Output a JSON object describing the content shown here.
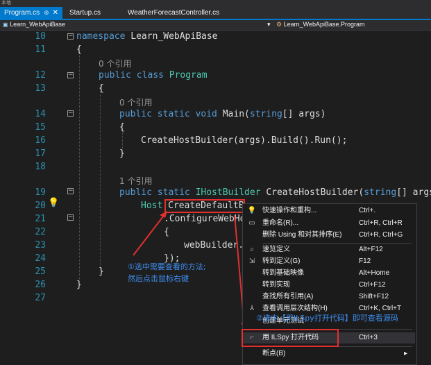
{
  "window": {
    "corner_label": "本地"
  },
  "tabs": [
    {
      "label": "Program.cs",
      "pin": "⊕",
      "close": "✕",
      "active": true
    },
    {
      "label": "Startup.cs",
      "active": false
    },
    {
      "label": "WeatherForecastController.cs",
      "active": false
    }
  ],
  "navbar": {
    "project": "Learn_WebApiBase",
    "dropdown_arrow": "▾",
    "member": "Learn_WebApiBase.Program"
  },
  "lines": [
    {
      "n": "10",
      "tokens": [
        {
          "t": "namespace ",
          "c": "kw"
        },
        {
          "t": "Learn_WebApiBase",
          "c": "fn"
        }
      ]
    },
    {
      "n": "11",
      "tokens": [
        {
          "t": "{",
          "c": "fn"
        }
      ]
    },
    {
      "n": "12",
      "ref": "0 个引用",
      "tokens": [
        {
          "t": "public class ",
          "c": "kw"
        },
        {
          "t": "Program",
          "c": "ty"
        }
      ]
    },
    {
      "n": "13",
      "tokens": [
        {
          "t": "{",
          "c": "fn"
        }
      ]
    },
    {
      "n": "14",
      "ref": "0 个引用",
      "tokens": [
        {
          "t": "public static void ",
          "c": "kw"
        },
        {
          "t": "Main(",
          "c": "fn"
        },
        {
          "t": "string",
          "c": "kw"
        },
        {
          "t": "[] args)",
          "c": "fn"
        }
      ]
    },
    {
      "n": "15",
      "tokens": [
        {
          "t": "{",
          "c": "fn"
        }
      ]
    },
    {
      "n": "16",
      "tokens": [
        {
          "t": "CreateHostBuilder(args).Build().Run();",
          "c": "fn"
        }
      ]
    },
    {
      "n": "17",
      "tokens": [
        {
          "t": "}",
          "c": "fn"
        }
      ]
    },
    {
      "n": "18",
      "tokens": []
    },
    {
      "n": "19",
      "ref": "1 个引用",
      "tokens": [
        {
          "t": "public static ",
          "c": "kw"
        },
        {
          "t": "IHostBuilder ",
          "c": "ty"
        },
        {
          "t": "CreateHostBuilder(",
          "c": "fn"
        },
        {
          "t": "string",
          "c": "kw"
        },
        {
          "t": "[] args",
          "c": "fn"
        }
      ]
    },
    {
      "n": "20",
      "tokens": [
        {
          "t": "Host.",
          "c": "ty"
        },
        {
          "t": "CreateDefaultB",
          "c": "fn"
        }
      ]
    },
    {
      "n": "21",
      "tokens": [
        {
          "t": ".ConfigureWebHo",
          "c": "fn"
        }
      ]
    },
    {
      "n": "22",
      "tokens": [
        {
          "t": "{",
          "c": "fn"
        }
      ]
    },
    {
      "n": "23",
      "tokens": [
        {
          "t": "webBuilder.",
          "c": "fn"
        }
      ]
    },
    {
      "n": "24",
      "tokens": [
        {
          "t": "});",
          "c": "fn"
        }
      ]
    },
    {
      "n": "25",
      "tokens": [
        {
          "t": "}",
          "c": "fn"
        }
      ]
    },
    {
      "n": "26",
      "tokens": [
        {
          "t": "}",
          "c": "fn"
        }
      ]
    },
    {
      "n": "27",
      "tokens": []
    }
  ],
  "context_menu": {
    "items": [
      {
        "label": "快速操作和重构...",
        "shortcut": "Ctrl+.",
        "icon": "lightbulb-icon",
        "glyph": "💡"
      },
      {
        "label": "重命名(R)...",
        "shortcut": "Ctrl+R, Ctrl+R",
        "icon": "rename-icon",
        "glyph": "▭"
      },
      {
        "label": "删除 Using 和对其排序(E)",
        "shortcut": "Ctrl+R, Ctrl+G",
        "icon": "",
        "glyph": ""
      },
      {
        "label": "速览定义",
        "shortcut": "Alt+F12",
        "icon": "peek-icon",
        "glyph": "⌕"
      },
      {
        "label": "转到定义(G)",
        "shortcut": "F12",
        "icon": "goto-definition-icon",
        "glyph": "⇲"
      },
      {
        "label": "转到基础映像",
        "shortcut": "Alt+Home",
        "icon": "",
        "glyph": ""
      },
      {
        "label": "转到实现",
        "shortcut": "Ctrl+F12",
        "icon": "",
        "glyph": ""
      },
      {
        "label": "查找所有引用(A)",
        "shortcut": "Shift+F12",
        "icon": "",
        "glyph": ""
      },
      {
        "label": "查看调用层次结构(H)",
        "shortcut": "Ctrl+K, Ctrl+T",
        "icon": "call-hierarchy-icon",
        "glyph": "⅄"
      },
      {
        "label": "创建单元测试",
        "shortcut": "",
        "icon": "",
        "glyph": ""
      },
      {
        "label": "用 ILSpy 打开代码",
        "shortcut": "Ctrl+3",
        "icon": "ilspy-icon",
        "glyph": "⌐"
      },
      {
        "label": "断点(B)",
        "shortcut": "",
        "icon": "",
        "glyph": "",
        "submenu": "▸"
      }
    ]
  },
  "annotations": {
    "step1_line1": "①选中需要查看的方法;",
    "step1_line2": "然后点击鼠标右键",
    "step2": "②选中【用ILSpy打开代码】即可查看源码"
  }
}
